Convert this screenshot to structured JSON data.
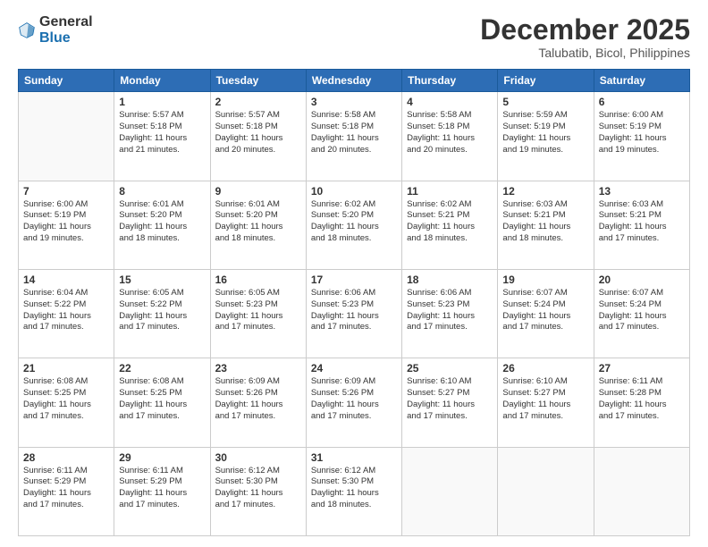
{
  "logo": {
    "general": "General",
    "blue": "Blue"
  },
  "header": {
    "month": "December 2025",
    "location": "Talubatib, Bicol, Philippines"
  },
  "days_of_week": [
    "Sunday",
    "Monday",
    "Tuesday",
    "Wednesday",
    "Thursday",
    "Friday",
    "Saturday"
  ],
  "weeks": [
    [
      {
        "day": "",
        "info": ""
      },
      {
        "day": "1",
        "info": "Sunrise: 5:57 AM\nSunset: 5:18 PM\nDaylight: 11 hours\nand 21 minutes."
      },
      {
        "day": "2",
        "info": "Sunrise: 5:57 AM\nSunset: 5:18 PM\nDaylight: 11 hours\nand 20 minutes."
      },
      {
        "day": "3",
        "info": "Sunrise: 5:58 AM\nSunset: 5:18 PM\nDaylight: 11 hours\nand 20 minutes."
      },
      {
        "day": "4",
        "info": "Sunrise: 5:58 AM\nSunset: 5:18 PM\nDaylight: 11 hours\nand 20 minutes."
      },
      {
        "day": "5",
        "info": "Sunrise: 5:59 AM\nSunset: 5:19 PM\nDaylight: 11 hours\nand 19 minutes."
      },
      {
        "day": "6",
        "info": "Sunrise: 6:00 AM\nSunset: 5:19 PM\nDaylight: 11 hours\nand 19 minutes."
      }
    ],
    [
      {
        "day": "7",
        "info": "Sunrise: 6:00 AM\nSunset: 5:19 PM\nDaylight: 11 hours\nand 19 minutes."
      },
      {
        "day": "8",
        "info": "Sunrise: 6:01 AM\nSunset: 5:20 PM\nDaylight: 11 hours\nand 18 minutes."
      },
      {
        "day": "9",
        "info": "Sunrise: 6:01 AM\nSunset: 5:20 PM\nDaylight: 11 hours\nand 18 minutes."
      },
      {
        "day": "10",
        "info": "Sunrise: 6:02 AM\nSunset: 5:20 PM\nDaylight: 11 hours\nand 18 minutes."
      },
      {
        "day": "11",
        "info": "Sunrise: 6:02 AM\nSunset: 5:21 PM\nDaylight: 11 hours\nand 18 minutes."
      },
      {
        "day": "12",
        "info": "Sunrise: 6:03 AM\nSunset: 5:21 PM\nDaylight: 11 hours\nand 18 minutes."
      },
      {
        "day": "13",
        "info": "Sunrise: 6:03 AM\nSunset: 5:21 PM\nDaylight: 11 hours\nand 17 minutes."
      }
    ],
    [
      {
        "day": "14",
        "info": "Sunrise: 6:04 AM\nSunset: 5:22 PM\nDaylight: 11 hours\nand 17 minutes."
      },
      {
        "day": "15",
        "info": "Sunrise: 6:05 AM\nSunset: 5:22 PM\nDaylight: 11 hours\nand 17 minutes."
      },
      {
        "day": "16",
        "info": "Sunrise: 6:05 AM\nSunset: 5:23 PM\nDaylight: 11 hours\nand 17 minutes."
      },
      {
        "day": "17",
        "info": "Sunrise: 6:06 AM\nSunset: 5:23 PM\nDaylight: 11 hours\nand 17 minutes."
      },
      {
        "day": "18",
        "info": "Sunrise: 6:06 AM\nSunset: 5:23 PM\nDaylight: 11 hours\nand 17 minutes."
      },
      {
        "day": "19",
        "info": "Sunrise: 6:07 AM\nSunset: 5:24 PM\nDaylight: 11 hours\nand 17 minutes."
      },
      {
        "day": "20",
        "info": "Sunrise: 6:07 AM\nSunset: 5:24 PM\nDaylight: 11 hours\nand 17 minutes."
      }
    ],
    [
      {
        "day": "21",
        "info": "Sunrise: 6:08 AM\nSunset: 5:25 PM\nDaylight: 11 hours\nand 17 minutes."
      },
      {
        "day": "22",
        "info": "Sunrise: 6:08 AM\nSunset: 5:25 PM\nDaylight: 11 hours\nand 17 minutes."
      },
      {
        "day": "23",
        "info": "Sunrise: 6:09 AM\nSunset: 5:26 PM\nDaylight: 11 hours\nand 17 minutes."
      },
      {
        "day": "24",
        "info": "Sunrise: 6:09 AM\nSunset: 5:26 PM\nDaylight: 11 hours\nand 17 minutes."
      },
      {
        "day": "25",
        "info": "Sunrise: 6:10 AM\nSunset: 5:27 PM\nDaylight: 11 hours\nand 17 minutes."
      },
      {
        "day": "26",
        "info": "Sunrise: 6:10 AM\nSunset: 5:27 PM\nDaylight: 11 hours\nand 17 minutes."
      },
      {
        "day": "27",
        "info": "Sunrise: 6:11 AM\nSunset: 5:28 PM\nDaylight: 11 hours\nand 17 minutes."
      }
    ],
    [
      {
        "day": "28",
        "info": "Sunrise: 6:11 AM\nSunset: 5:29 PM\nDaylight: 11 hours\nand 17 minutes."
      },
      {
        "day": "29",
        "info": "Sunrise: 6:11 AM\nSunset: 5:29 PM\nDaylight: 11 hours\nand 17 minutes."
      },
      {
        "day": "30",
        "info": "Sunrise: 6:12 AM\nSunset: 5:30 PM\nDaylight: 11 hours\nand 17 minutes."
      },
      {
        "day": "31",
        "info": "Sunrise: 6:12 AM\nSunset: 5:30 PM\nDaylight: 11 hours\nand 18 minutes."
      },
      {
        "day": "",
        "info": ""
      },
      {
        "day": "",
        "info": ""
      },
      {
        "day": "",
        "info": ""
      }
    ]
  ]
}
